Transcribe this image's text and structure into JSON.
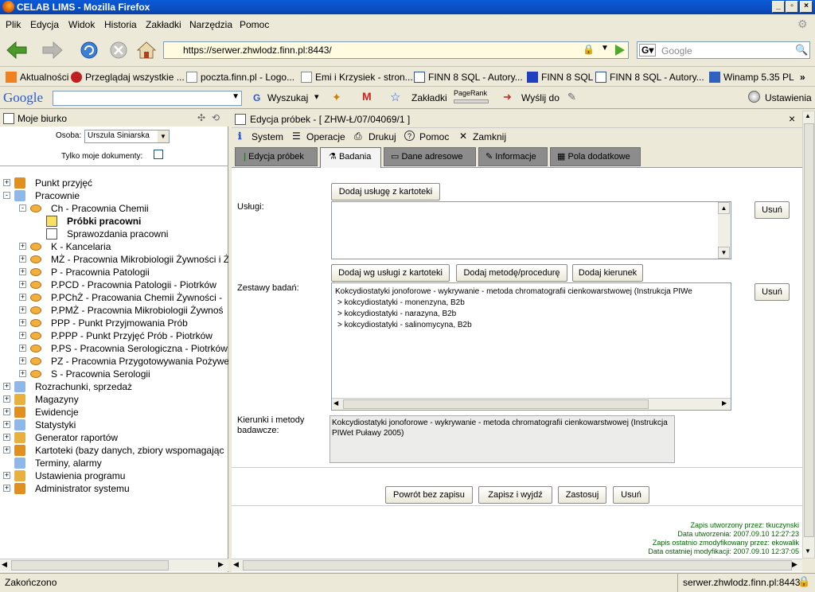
{
  "window": {
    "title": "CELAB LIMS - Mozilla Firefox"
  },
  "menu": [
    "Plik",
    "Edycja",
    "Widok",
    "Historia",
    "Zakładki",
    "Narzędzia",
    "Pomoc"
  ],
  "nav": {
    "url": "https://serwer.zhwlodz.finn.pl:8443/",
    "search_placeholder": "Google"
  },
  "bookmarks": [
    "Aktualności",
    "Przeglądaj wszystkie ...",
    "poczta.finn.pl - Logo...",
    "Emi i Krzysiek - stron...",
    "FINN 8 SQL - Autory...",
    "FINN 8 SQL",
    "FINN 8 SQL - Autory...",
    "Winamp 5.35 PL"
  ],
  "google_toolbar": {
    "logo": "Google",
    "search_label": "Wyszukaj",
    "zakladki": "Zakładki",
    "pagerank": "PageRank",
    "wyslij": "Wyślij do",
    "ustawienia": "Ustawienia"
  },
  "left": {
    "title": "Moje biurko",
    "osoba_label": "Osoba:",
    "osoba_value": "Urszula Siniarska",
    "tylko_label": "Tylko moje dokumenty:",
    "tree": [
      {
        "label": "Punkt przyjęć",
        "level": 0,
        "pm": "+"
      },
      {
        "label": "Pracownie",
        "level": 0,
        "pm": "-"
      },
      {
        "label": "Ch - Pracownia Chemii",
        "level": 1,
        "pm": "-"
      },
      {
        "label": "Próbki pracowni",
        "level": 2,
        "pm": "",
        "bold": true
      },
      {
        "label": "Sprawozdania pracowni",
        "level": 2,
        "pm": ""
      },
      {
        "label": "K - Kancelaria",
        "level": 1,
        "pm": "+"
      },
      {
        "label": "MŻ - Pracownia Mikrobiologii Żywności i Ż",
        "level": 1,
        "pm": "+"
      },
      {
        "label": "P - Pracownia Patologii",
        "level": 1,
        "pm": "+"
      },
      {
        "label": "P.PCD - Pracownia Patologii - Piotrków",
        "level": 1,
        "pm": "+"
      },
      {
        "label": "P.PChŻ - Pracowania Chemii Żywności -",
        "level": 1,
        "pm": "+"
      },
      {
        "label": "P.PMŻ - Pracownia Mikrobiologii Żywnoś",
        "level": 1,
        "pm": "+"
      },
      {
        "label": "PPP - Punkt Przyjmowania Prób",
        "level": 1,
        "pm": "+"
      },
      {
        "label": "P.PPP - Punkt Przyjęć Prób - Piotrków",
        "level": 1,
        "pm": "+"
      },
      {
        "label": "P.PS - Pracownia Serologiczna - Piotrków",
        "level": 1,
        "pm": "+"
      },
      {
        "label": "PZ - Pracownia Przygotowywania Pożywe",
        "level": 1,
        "pm": "+"
      },
      {
        "label": "S - Pracownia Serologii",
        "level": 1,
        "pm": "+"
      },
      {
        "label": "Rozrachunki, sprzedaż",
        "level": 0,
        "pm": "+"
      },
      {
        "label": "Magazyny",
        "level": 0,
        "pm": "+"
      },
      {
        "label": "Ewidencje",
        "level": 0,
        "pm": "+"
      },
      {
        "label": "Statystyki",
        "level": 0,
        "pm": "+"
      },
      {
        "label": "Generator raportów",
        "level": 0,
        "pm": "+"
      },
      {
        "label": "Kartoteki (bazy danych, zbiory wspomagając",
        "level": 0,
        "pm": "+"
      },
      {
        "label": "Terminy, alarmy",
        "level": 0,
        "pm": ""
      },
      {
        "label": "Ustawienia programu",
        "level": 0,
        "pm": "+"
      },
      {
        "label": "Administrator systemu",
        "level": 0,
        "pm": "+"
      }
    ]
  },
  "right": {
    "title": "Edycja próbek - [ ZHW-Ł/07/04069/1 ]",
    "toolbar": [
      "System",
      "Operacje",
      "Drukuj",
      "Pomoc",
      "Zamknij"
    ],
    "tabs": [
      "Edycja próbek",
      "Badania",
      "Dane adresowe",
      "Informacje",
      "Pola dodatkowe"
    ],
    "uslugi_label": "Usługi:",
    "dodaj_usluge": "Dodaj usługę z kartoteki",
    "usun": "Usuń",
    "dodaj_wg": "Dodaj wg usługi z kartoteki",
    "dodaj_metode": "Dodaj metodę/procedurę",
    "dodaj_kierunek": "Dodaj kierunek",
    "zestawy_label": "Zestawy badań:",
    "zestawy": [
      "Kokcydiostatyki jonoforowe - wykrywanie - metoda chromatografii cienkowarstwowej (Instrukcja PIWe",
      " > kokcydiostatyki - monenzyna, B2b",
      " > kokcydiostatyki - narazyna, B2b",
      " > kokcydiostatyki - salinomycyna, B2b"
    ],
    "kierunki_label": "Kierunki i metody badawcze:",
    "kierunki_text": "Kokcydiostatyki jonoforowe - wykrywanie - metoda chromatografii cienkowarstwowej (Instrukcja PIWet Puławy 2005)",
    "bottom_buttons": [
      "Powrót bez zapisu",
      "Zapisz i wyjdź",
      "Zastosuj",
      "Usuń"
    ],
    "info": [
      "Zapis utworzony przez: tkuczynski",
      "Data utworzenia: 2007.09.10 12:27:23",
      "Zapis ostatnio zmodyfikowany przez: ekowalik",
      "Data ostatniej modyfikacji: 2007.09.10 12:37:05"
    ]
  },
  "status": {
    "left": "Zakończono",
    "right": "serwer.zhwlodz.finn.pl:8443"
  }
}
